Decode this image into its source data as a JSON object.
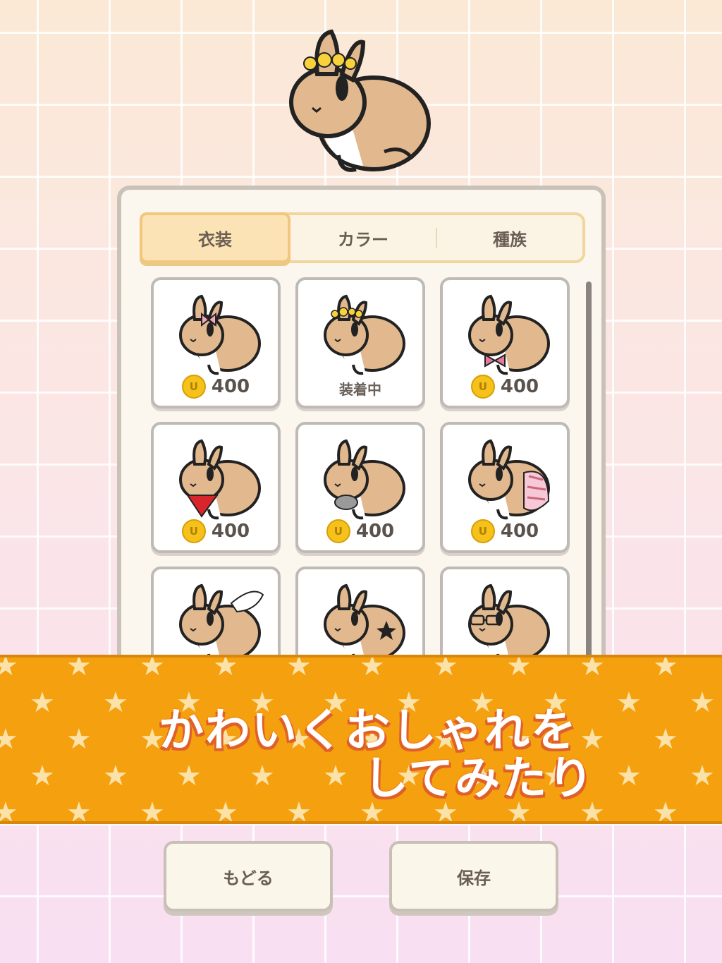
{
  "tabs": {
    "costume": "衣装",
    "color": "カラー",
    "breed": "種族"
  },
  "items": [
    {
      "name": "pink-ribbon",
      "price": "400"
    },
    {
      "name": "flower-crown",
      "price": "装着中"
    },
    {
      "name": "bow-tie",
      "price": "400"
    },
    {
      "name": "red-scarf",
      "price": "400"
    },
    {
      "name": "grey-bib",
      "price": "400"
    },
    {
      "name": "pink-diaper",
      "price": "400"
    },
    {
      "name": "angel-wings",
      "price": ""
    },
    {
      "name": "star-pattern",
      "price": ""
    },
    {
      "name": "glasses",
      "price": ""
    }
  ],
  "banner": {
    "line1": "かわいくおしゃれを",
    "line2": "してみたり"
  },
  "buttons": {
    "back": "もどる",
    "save": "保存"
  },
  "colors": {
    "accent": "#f5a00f",
    "coin": "#f4c21b",
    "bunny": "#e2b88e"
  },
  "icons": {
    "coin": "coin-icon",
    "star": "star-icon"
  }
}
